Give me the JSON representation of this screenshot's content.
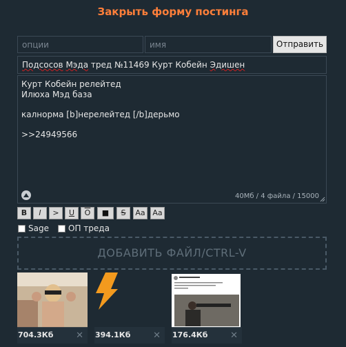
{
  "header": {
    "close_form_label": "Закрыть форму постинга"
  },
  "form": {
    "options_placeholder": "опции",
    "name_placeholder": "имя",
    "submit_label": "Отправить",
    "subject_parts": [
      "Подсосов",
      " ",
      "Мэда",
      " тред №11469 Курт Кобейн ",
      "Эдишен"
    ],
    "message_text": "Курт Кобейн релейтед\nИлюха Мэд база\n\nкалнорма [b]нерелейтед [/b]дерьмо\n\n>>24949566",
    "counter": "40Мб / 4 файла / 15000"
  },
  "toolbar": {
    "buttons": [
      "B",
      "I",
      ">",
      "U",
      "O",
      "■",
      "S",
      "Aa",
      "Aa"
    ]
  },
  "checkboxes": {
    "sage_label": "Sage",
    "op_label": "ОП треда"
  },
  "upload": {
    "dropzone_label": "ДОБАВИТЬ ФАЙЛ/CTRL-V"
  },
  "files": [
    {
      "size": "704.3Кб",
      "remove": "✕"
    },
    {
      "size": "394.1Кб",
      "remove": "✕"
    },
    {
      "size": "176.4Кб",
      "remove": "✕"
    }
  ],
  "colors": {
    "accent": "#ff7f3a",
    "background": "#1e2a33",
    "border": "#3b4955"
  }
}
